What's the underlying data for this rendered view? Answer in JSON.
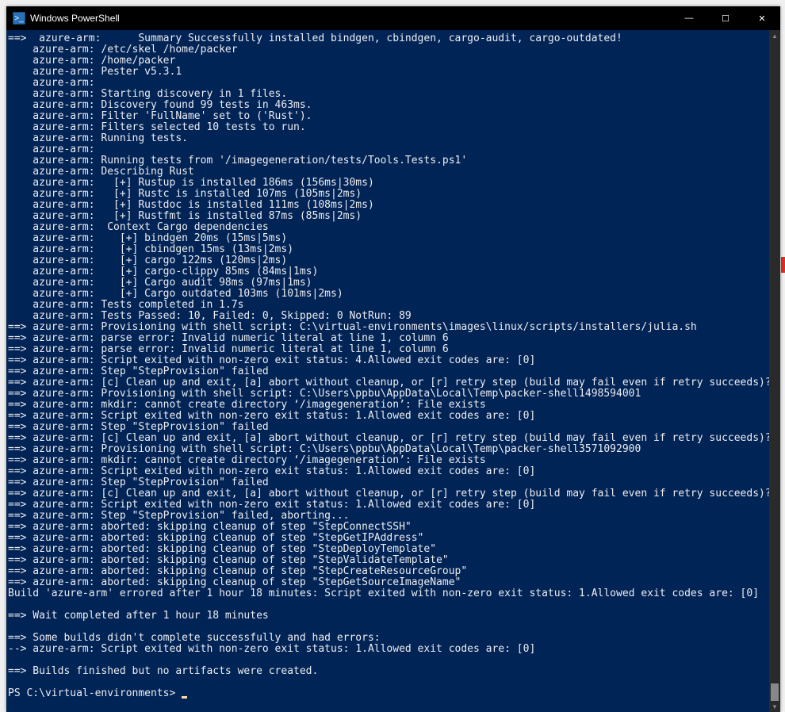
{
  "window": {
    "title": "Windows PowerShell",
    "icon_glyph": ">_"
  },
  "controls": {
    "minimize": "—",
    "maximize": "☐",
    "close": "✕"
  },
  "console_lines": [
    "==>  azure-arm:      Summary Successfully installed bindgen, cbindgen, cargo-audit, cargo-outdated!",
    "    azure-arm: /etc/skel /home/packer",
    "    azure-arm: /home/packer",
    "    azure-arm: Pester v5.3.1",
    "    azure-arm:",
    "    azure-arm: Starting discovery in 1 files.",
    "    azure-arm: Discovery found 99 tests in 463ms.",
    "    azure-arm: Filter 'FullName' set to ('Rust').",
    "    azure-arm: Filters selected 10 tests to run.",
    "    azure-arm: Running tests.",
    "    azure-arm:",
    "    azure-arm: Running tests from '/imagegeneration/tests/Tools.Tests.ps1'",
    "    azure-arm: Describing Rust",
    "    azure-arm:   [+] Rustup is installed 186ms (156ms|30ms)",
    "    azure-arm:   [+] Rustc is installed 107ms (105ms|2ms)",
    "    azure-arm:   [+] Rustdoc is installed 111ms (108ms|2ms)",
    "    azure-arm:   [+] Rustfmt is installed 87ms (85ms|2ms)",
    "    azure-arm:  Context Cargo dependencies",
    "    azure-arm:    [+] bindgen 20ms (15ms|5ms)",
    "    azure-arm:    [+] cbindgen 15ms (13ms|2ms)",
    "    azure-arm:    [+] cargo 122ms (120ms|2ms)",
    "    azure-arm:    [+] cargo-clippy 85ms (84ms|1ms)",
    "    azure-arm:    [+] Cargo audit 98ms (97ms|1ms)",
    "    azure-arm:    [+] Cargo outdated 103ms (101ms|2ms)",
    "    azure-arm: Tests completed in 1.7s",
    "    azure-arm: Tests Passed: 10, Failed: 0, Skipped: 0 NotRun: 89",
    "==> azure-arm: Provisioning with shell script: C:\\virtual-environments\\images\\linux/scripts/installers/julia.sh",
    "==> azure-arm: parse error: Invalid numeric literal at line 1, column 6",
    "==> azure-arm: parse error: Invalid numeric literal at line 1, column 6",
    "==> azure-arm: Script exited with non-zero exit status: 4.Allowed exit codes are: [0]",
    "==> azure-arm: Step \"StepProvision\" failed",
    "==> azure-arm: [c] Clean up and exit, [a] abort without cleanup, or [r] retry step (build may fail even if retry succeeds)? r",
    "==> azure-arm: Provisioning with shell script: C:\\Users\\ppbu\\AppData\\Local\\Temp\\packer-shell1498594001",
    "==> azure-arm: mkdir: cannot create directory ‘/imagegeneration’: File exists",
    "==> azure-arm: Script exited with non-zero exit status: 1.Allowed exit codes are: [0]",
    "==> azure-arm: Step \"StepProvision\" failed",
    "==> azure-arm: [c] Clean up and exit, [a] abort without cleanup, or [r] retry step (build may fail even if retry succeeds)? r",
    "==> azure-arm: Provisioning with shell script: C:\\Users\\ppbu\\AppData\\Local\\Temp\\packer-shell3571092900",
    "==> azure-arm: mkdir: cannot create directory ‘/imagegeneration’: File exists",
    "==> azure-arm: Script exited with non-zero exit status: 1.Allowed exit codes are: [0]",
    "==> azure-arm: Step \"StepProvision\" failed",
    "==> azure-arm: [c] Clean up and exit, [a] abort without cleanup, or [r] retry step (build may fail even if retry succeeds)? a",
    "==> azure-arm: Script exited with non-zero exit status: 1.Allowed exit codes are: [0]",
    "==> azure-arm: Step \"StepProvision\" failed, aborting...",
    "==> azure-arm: aborted: skipping cleanup of step \"StepConnectSSH\"",
    "==> azure-arm: aborted: skipping cleanup of step \"StepGetIPAddress\"",
    "==> azure-arm: aborted: skipping cleanup of step \"StepDeployTemplate\"",
    "==> azure-arm: aborted: skipping cleanup of step \"StepValidateTemplate\"",
    "==> azure-arm: aborted: skipping cleanup of step \"StepCreateResourceGroup\"",
    "==> azure-arm: aborted: skipping cleanup of step \"StepGetSourceImageName\"",
    "Build 'azure-arm' errored after 1 hour 18 minutes: Script exited with non-zero exit status: 1.Allowed exit codes are: [0]",
    "",
    "==> Wait completed after 1 hour 18 minutes",
    "",
    "==> Some builds didn't complete successfully and had errors:",
    "--> azure-arm: Script exited with non-zero exit status: 1.Allowed exit codes are: [0]",
    "",
    "==> Builds finished but no artifacts were created.",
    ""
  ],
  "prompt": "PS C:\\virtual-environments> "
}
